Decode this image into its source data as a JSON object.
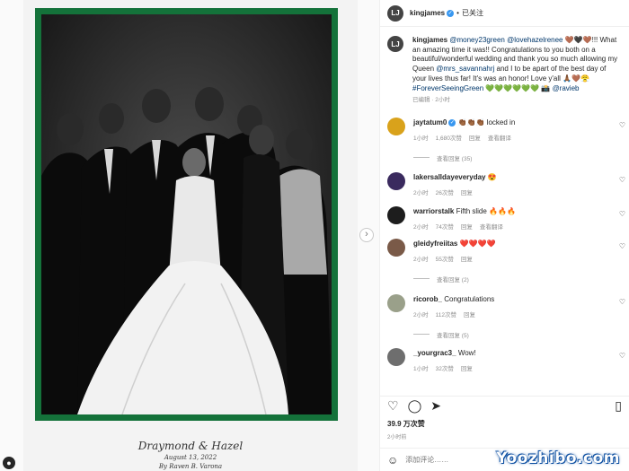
{
  "post": {
    "username": "kingjames",
    "follow_status": "已关注",
    "caption_user": "kingjames",
    "caption_parts": [
      {
        "t": "mention",
        "v": "@money23green"
      },
      {
        "t": "text",
        "v": " "
      },
      {
        "t": "mention",
        "v": "@lovehazelrenee"
      },
      {
        "t": "text",
        "v": " 🤎🖤🤎!!! What an amazing time it was!! Congratulations to you both on a beautiful/wonderful wedding and thank you so much allowing my Queen "
      },
      {
        "t": "mention",
        "v": "@mrs_savannahrj"
      },
      {
        "t": "text",
        "v": " and I to be apart of the best day of your lives thus far! It's was an honor! Love y'all 🙏🏾🤎😤 "
      },
      {
        "t": "mention",
        "v": "#ForeverSeeingGreen"
      },
      {
        "t": "text",
        "v": " 💚💚💚💚💚💚 📸 "
      },
      {
        "t": "mention",
        "v": "@ravieb"
      }
    ],
    "caption_meta": "已编辑 · 2小时",
    "likes": "39.9 万次赞",
    "time": "2小时前",
    "comment_placeholder": "添加评论……"
  },
  "photo_caption": {
    "names": "Draymond & Hazel",
    "date": "August 13, 2022",
    "by": "By Raven B. Varona"
  },
  "comments": [
    {
      "user": "jaytatum0",
      "verified": true,
      "text": "👏🏾👏🏾👏🏾 locked in",
      "time": "1小时",
      "likes": "1,680次赞",
      "reply": "回复",
      "translate": "查看翻译",
      "replies": "查看回复 (35)",
      "avatar_color": "#d9a21b"
    },
    {
      "user": "lakersalldayeveryday",
      "verified": false,
      "text": "😍",
      "time": "2小时",
      "likes": "26次赞",
      "reply": "回复",
      "translate": "",
      "replies": "",
      "avatar_color": "#3a2a5e"
    },
    {
      "user": "warriorstalk",
      "verified": false,
      "text": "Fifth slide 🔥🔥🔥",
      "time": "2小时",
      "likes": "74次赞",
      "reply": "回复",
      "translate": "查看翻译",
      "replies": "",
      "avatar_color": "#1d1d1d"
    },
    {
      "user": "gleidyfreiitas",
      "verified": false,
      "text": "❤️❤️❤️❤️",
      "time": "2小时",
      "likes": "55次赞",
      "reply": "回复",
      "translate": "",
      "replies": "查看回复 (2)",
      "avatar_color": "#7a5a48"
    },
    {
      "user": "ricorob_",
      "verified": false,
      "text": "Congratulations",
      "time": "2小时",
      "likes": "112次赞",
      "reply": "回复",
      "translate": "",
      "replies": "查看回复 (5)",
      "avatar_color": "#9aa08a"
    },
    {
      "user": "_yourgrac3_",
      "verified": false,
      "text": "Wow!",
      "time": "1小时",
      "likes": "32次赞",
      "reply": "回复",
      "translate": "",
      "replies": "",
      "avatar_color": "#6e6e6e"
    }
  ],
  "watermark": "Yoozhibo.com",
  "icons": {
    "like": "heart-icon",
    "comment": "comment-icon",
    "share": "share-icon",
    "save": "bookmark-icon",
    "emoji": "emoji-icon",
    "next": "chevron-right-icon"
  }
}
